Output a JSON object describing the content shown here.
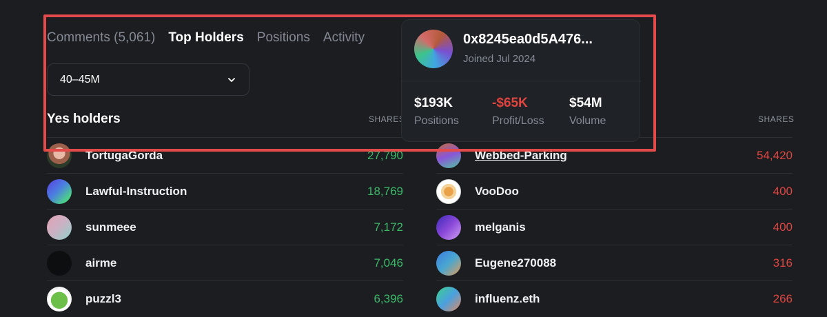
{
  "tabs": [
    {
      "label": "Comments (5,061)",
      "active": false
    },
    {
      "label": "Top Holders",
      "active": true
    },
    {
      "label": "Positions",
      "active": false
    },
    {
      "label": "Activity",
      "active": false
    }
  ],
  "range_select": {
    "value": "40–45M"
  },
  "yes_holders": {
    "title": "Yes holders",
    "shares_header": "SHARES",
    "rows": [
      {
        "name": "TortugaGorda",
        "shares": "27,790"
      },
      {
        "name": "Lawful-Instruction",
        "shares": "18,769"
      },
      {
        "name": "sunmeee",
        "shares": "7,172"
      },
      {
        "name": "airme",
        "shares": "7,046"
      },
      {
        "name": "puzzl3",
        "shares": "6,396"
      }
    ]
  },
  "no_holders": {
    "shares_header": "SHARES",
    "rows": [
      {
        "name": "Webbed-Parking",
        "shares": "54,420"
      },
      {
        "name": "VooDoo",
        "shares": "400"
      },
      {
        "name": "melganis",
        "shares": "400"
      },
      {
        "name": "Eugene270088",
        "shares": "316"
      },
      {
        "name": "influenz.eth",
        "shares": "266"
      }
    ]
  },
  "profile_card": {
    "address": "0x8245ea0d5A476...",
    "joined": "Joined Jul 2024",
    "stats": {
      "positions": {
        "value": "$193K",
        "label": "Positions"
      },
      "profit_loss": {
        "value": "-$65K",
        "label": "Profit/Loss"
      },
      "volume": {
        "value": "$54M",
        "label": "Volume"
      }
    }
  },
  "colors": {
    "background": "#1b1d21",
    "yes_shares": "#3dba69",
    "no_shares": "#e0453f",
    "highlight": "#e34b4b"
  }
}
